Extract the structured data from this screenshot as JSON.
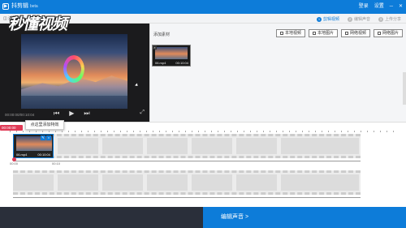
{
  "app": {
    "title": "抖剪辑",
    "version": "beta",
    "top_right": [
      "登录",
      "设置",
      "─",
      "✕"
    ]
  },
  "steps": [
    {
      "num": "1",
      "label": "剪辑视频",
      "active": true
    },
    {
      "num": "2",
      "label": "编辑声音",
      "active": false
    },
    {
      "num": "3",
      "label": "上传分享",
      "active": false
    }
  ],
  "back_label": "返回首页",
  "watermark": "秒懂视频",
  "preview": {
    "timecode": "00:00:00/00:10:04"
  },
  "material": {
    "label": "添加素材",
    "buttons": [
      "本地视频",
      "本地图片",
      "网络视频",
      "网络图片"
    ],
    "item": {
      "name": "06.mp4",
      "duration": "00:10:04"
    }
  },
  "timeline": {
    "marker": "00:00:00",
    "tooltip": "点这里添加特效",
    "clip": {
      "name": "06.mp4",
      "duration": "00:10:04"
    },
    "tick_labels": [
      "00:00",
      "00:10"
    ]
  },
  "footer": {
    "next_label": "编辑声音 >"
  },
  "colors": {
    "brand": "#0d7cd9",
    "marker": "#e03a56"
  }
}
